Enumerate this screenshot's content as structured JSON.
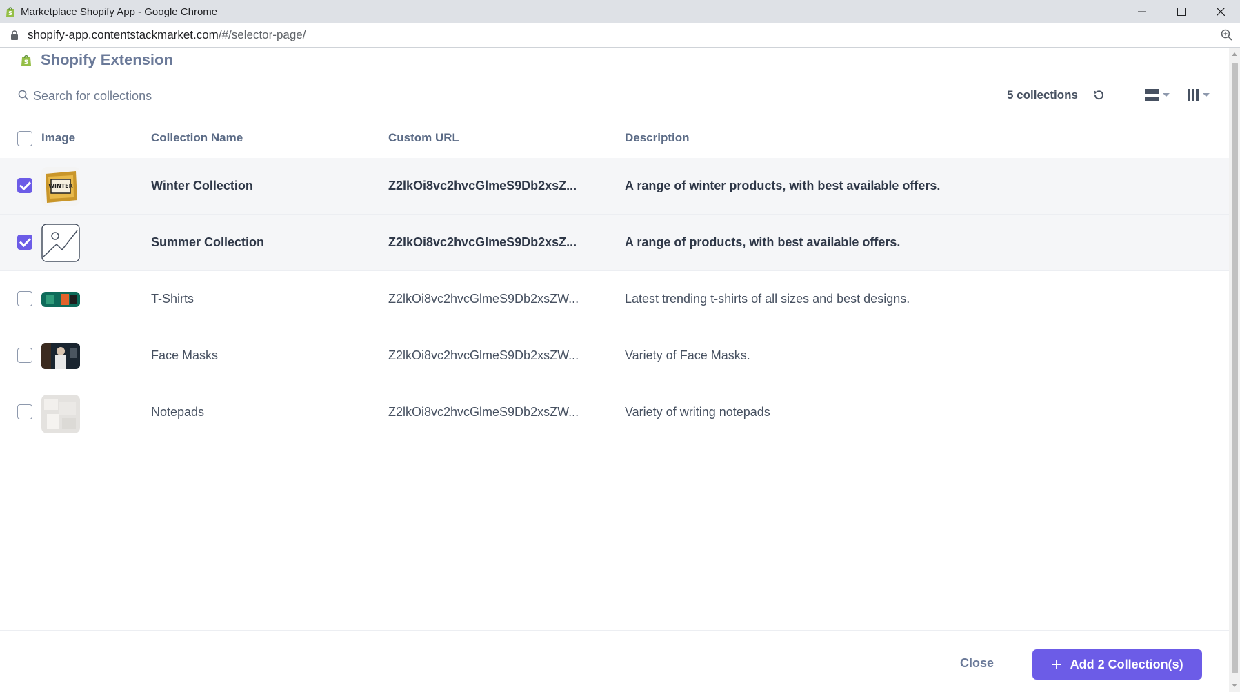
{
  "window": {
    "title": "Marketplace Shopify App - Google Chrome",
    "url_main": "shopify-app.contentstackmarket.com",
    "url_path": "/#/selector-page/"
  },
  "app": {
    "title": "Shopify Extension"
  },
  "toolbar": {
    "search_placeholder": "Search for collections",
    "count_label": "5 collections"
  },
  "table": {
    "headers": {
      "image": "Image",
      "name": "Collection Name",
      "url": "Custom URL",
      "description": "Description"
    },
    "rows": [
      {
        "selected": true,
        "thumb": "winter",
        "name": "Winter Collection",
        "url": "Z2lkOi8vc2hvcGlmeS9Db2xsZ...",
        "description": "A range of winter products, with best available offers."
      },
      {
        "selected": true,
        "thumb": "placeholder",
        "name": "Summer Collection",
        "url": "Z2lkOi8vc2hvcGlmeS9Db2xsZ...",
        "description": "A range of products, with best available offers."
      },
      {
        "selected": false,
        "thumb": "tshirts",
        "name": "T-Shirts",
        "url": "Z2lkOi8vc2hvcGlmeS9Db2xsZW...",
        "description": "Latest trending t-shirts of all sizes and best designs."
      },
      {
        "selected": false,
        "thumb": "masks",
        "name": "Face Masks",
        "url": "Z2lkOi8vc2hvcGlmeS9Db2xsZW...",
        "description": "Variety of Face Masks."
      },
      {
        "selected": false,
        "thumb": "notepads",
        "name": "Notepads",
        "url": "Z2lkOi8vc2hvcGlmeS9Db2xsZW...",
        "description": "Variety of writing notepads"
      }
    ]
  },
  "footer": {
    "close_label": "Close",
    "add_label": "Add 2 Collection(s)"
  },
  "colors": {
    "accent": "#6c5ce7",
    "header_text": "#6b7a99"
  }
}
